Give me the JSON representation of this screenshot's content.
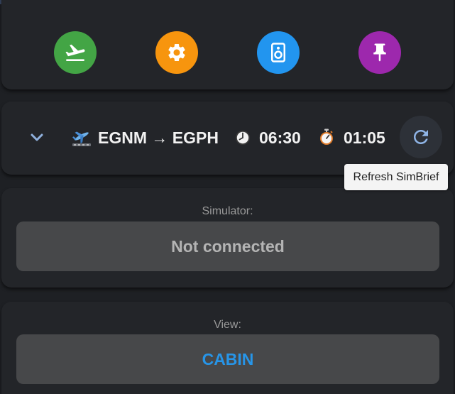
{
  "toolbar": {
    "buttons": [
      {
        "icon": "airplane-departure-icon",
        "color": "#43a545"
      },
      {
        "icon": "gear-icon",
        "color": "#f7950e"
      },
      {
        "icon": "speaker-icon",
        "color": "#2295ef"
      },
      {
        "icon": "pushpin-icon",
        "color": "#9d28ad"
      }
    ]
  },
  "flight": {
    "route": "EGNM → EGPH",
    "departure_time": "06:30",
    "duration": "01:05",
    "refresh_tooltip": "Refresh SimBrief"
  },
  "simulator": {
    "label": "Simulator:",
    "status": "Not connected"
  },
  "view": {
    "label": "View:",
    "value": "CABIN",
    "accent": "#2795e8"
  }
}
